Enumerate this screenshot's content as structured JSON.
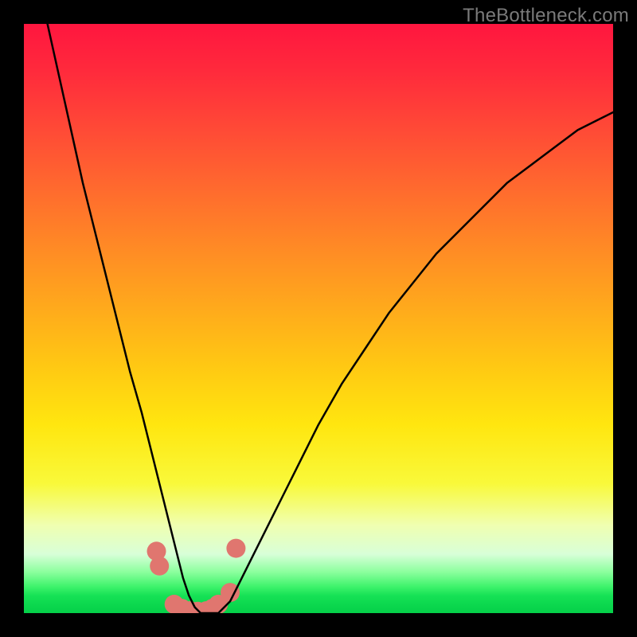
{
  "watermark": "TheBottleneck.com",
  "chart_data": {
    "type": "line",
    "title": "",
    "xlabel": "",
    "ylabel": "",
    "xlim": [
      0,
      100
    ],
    "ylim": [
      0,
      100
    ],
    "grid": false,
    "legend": false,
    "background_gradient": {
      "direction": "top-to-bottom",
      "stops": [
        {
          "pos": 0.0,
          "color": "#ff163f"
        },
        {
          "pos": 0.48,
          "color": "#ffa91c"
        },
        {
          "pos": 0.78,
          "color": "#f9f93a"
        },
        {
          "pos": 0.9,
          "color": "#d8ffd8"
        },
        {
          "pos": 1.0,
          "color": "#05d049"
        }
      ]
    },
    "series": [
      {
        "name": "bottleneck-curve",
        "color": "#000000",
        "stroke_width": 2.5,
        "x": [
          4,
          6,
          8,
          10,
          12,
          14,
          16,
          18,
          20,
          22,
          23,
          24,
          25,
          26,
          27,
          28,
          29,
          30,
          31,
          32,
          33,
          34,
          35,
          36,
          38,
          40,
          42,
          44,
          46,
          48,
          50,
          54,
          58,
          62,
          66,
          70,
          74,
          78,
          82,
          86,
          90,
          94,
          98,
          100
        ],
        "y": [
          100,
          91,
          82,
          73,
          65,
          57,
          49,
          41,
          34,
          26,
          22,
          18,
          14,
          10,
          6,
          3,
          1,
          0,
          0,
          0,
          0,
          1,
          2,
          4,
          8,
          12,
          16,
          20,
          24,
          28,
          32,
          39,
          45,
          51,
          56,
          61,
          65,
          69,
          73,
          76,
          79,
          82,
          84,
          85
        ]
      },
      {
        "name": "highlight-dots",
        "type": "scatter",
        "color": "#e0766f",
        "radius": 12,
        "x": [
          22.5,
          23.0,
          25.5,
          26.8,
          28.2,
          29.5,
          31.0,
          32.0,
          33.0,
          35.0,
          36.0
        ],
        "y": [
          10.5,
          8.0,
          1.5,
          0.8,
          0.4,
          0.3,
          0.4,
          0.8,
          1.5,
          3.5,
          11.0
        ]
      }
    ]
  }
}
